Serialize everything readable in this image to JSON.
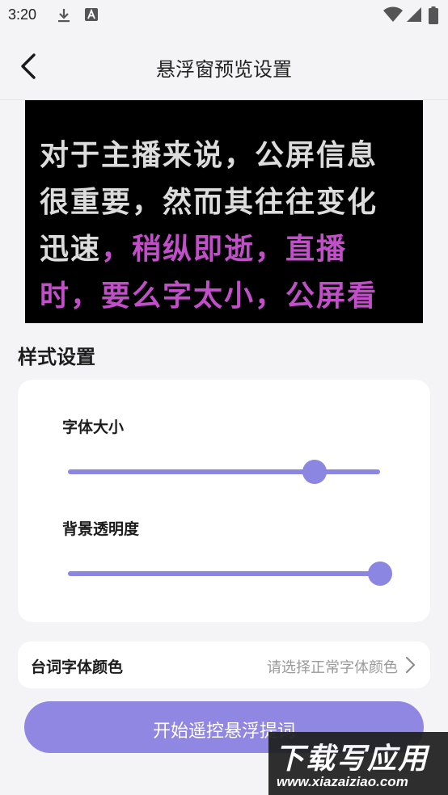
{
  "status_bar": {
    "time": "3:20",
    "icons": [
      "download-icon",
      "a-letter-icon",
      "wifi-icon",
      "signal-icon",
      "battery-icon"
    ]
  },
  "header": {
    "title": "悬浮窗预览设置",
    "back_icon": "chevron-left-icon"
  },
  "preview": {
    "line1": "对于主播来说，公屏信息",
    "line2": "很重要，然而其往往变化",
    "line3_normal": "迅速",
    "line3_highlight": "，稍纵即逝，直播",
    "line4_highlight": "时，要么字太小，公屏看",
    "colors": {
      "background": "#000000",
      "normal_text": "#dcdcdc",
      "highlight_text": "#c24fc9"
    }
  },
  "style_section": {
    "title": "样式设置",
    "font_size": {
      "label": "字体大小",
      "value_fraction": 0.79
    },
    "bg_opacity": {
      "label": "背景透明度",
      "value_fraction": 1.0
    }
  },
  "line_color": {
    "label": "台词字体颜色",
    "value": "请选择正常字体颜色"
  },
  "start_button": {
    "label": "开始遥控悬浮提词"
  },
  "watermark": {
    "main": "下载写应用",
    "sub": "www.xiazaiziao.com"
  },
  "colors": {
    "accent": "#8c86e3",
    "page_bg": "#f4f4f7",
    "card_bg": "#ffffff"
  }
}
